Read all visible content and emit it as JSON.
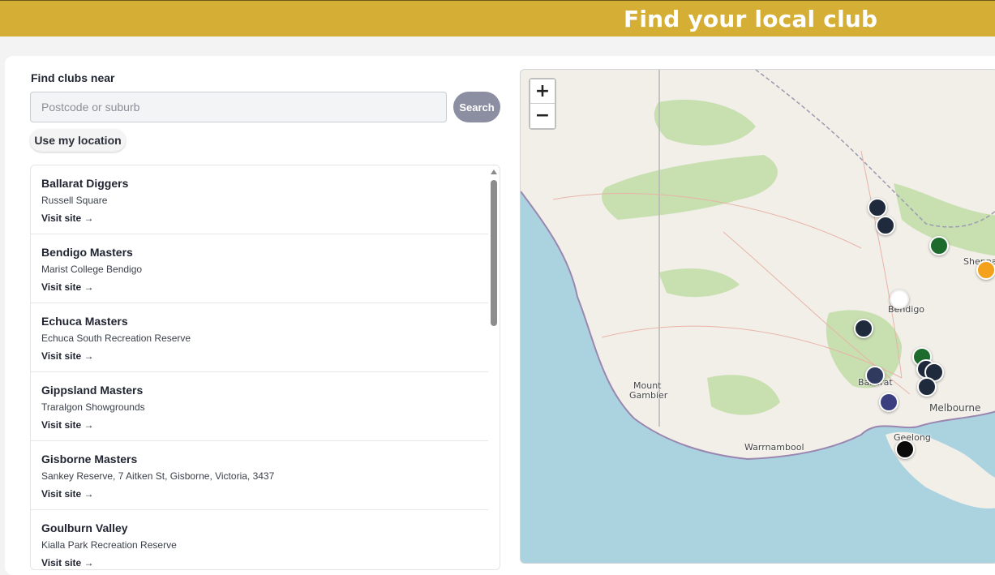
{
  "header": {
    "title": "Find your local club"
  },
  "search": {
    "label": "Find clubs near",
    "placeholder": "Postcode or suburb",
    "value": "",
    "search_button": "Search",
    "location_button": "Use my location"
  },
  "clubs": [
    {
      "name": "Ballarat Diggers",
      "venue": "Russell Square",
      "link": "Visit site →"
    },
    {
      "name": "Bendigo Masters",
      "venue": "Marist College Bendigo",
      "link": "Visit site →"
    },
    {
      "name": "Echuca Masters",
      "venue": "Echuca South Recreation Reserve",
      "link": "Visit site →"
    },
    {
      "name": "Gippsland Masters",
      "venue": "Traralgon Showgrounds",
      "link": "Visit site →"
    },
    {
      "name": "Gisborne Masters",
      "venue": "Sankey Reserve, 7 Aitken St, Gisborne, Victoria, 3437",
      "link": "Visit site →"
    },
    {
      "name": "Goulburn Valley",
      "venue": "Kialla Park Recreation Reserve",
      "link": "Visit site →"
    }
  ],
  "map": {
    "zoom_in": "+",
    "zoom_out": "−",
    "places": [
      "Mount",
      "Gambier",
      "Warrnambool",
      "Bendigo",
      "Ballarat",
      "Melbourne",
      "Geelong",
      "Shepparton"
    ],
    "marker_colors": {
      "navy": "#1f2a3c",
      "green": "#1e6b2e",
      "orange": "#f4a21c",
      "white": "#ffffff",
      "purple": "#3b3f80",
      "black": "#0a0a0a"
    }
  },
  "colors": {
    "banner": "#d4ae35",
    "ocean": "#aad3df",
    "land": "#f2efe9",
    "park": "#c8dfb0"
  }
}
